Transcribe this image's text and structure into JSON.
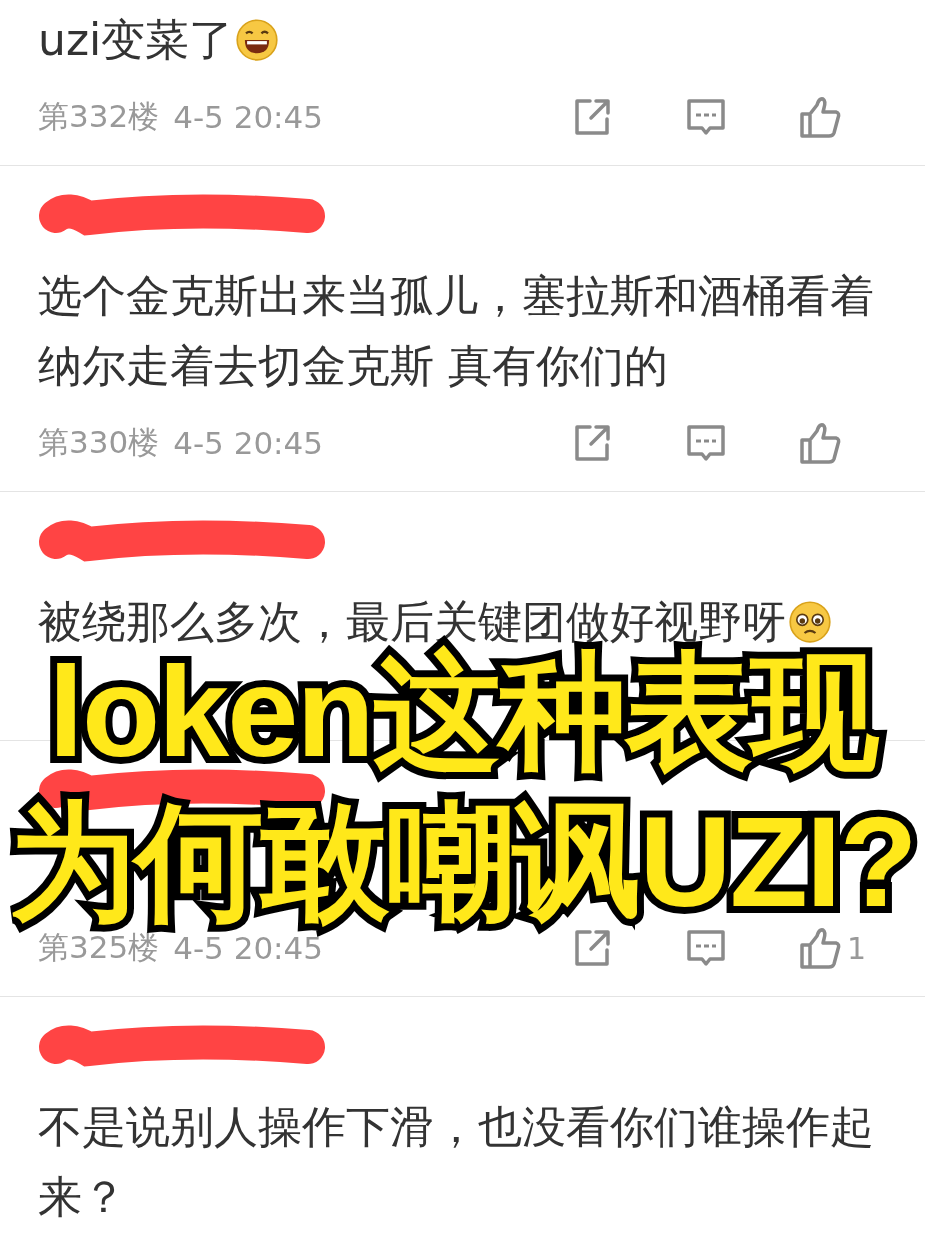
{
  "comments": [
    {
      "redacted": false,
      "lines": [
        "uzi变菜了"
      ],
      "emoji": {
        "kind": "laugh"
      },
      "floor": "第332楼",
      "time": "4-5 20:45"
    },
    {
      "redacted": true,
      "lines": [
        "选个金克斯出来当孤儿，塞拉斯和酒桶看着",
        "纳尔走着去切金克斯 真有你们的"
      ],
      "floor": "第330楼",
      "time": "4-5 20:45"
    },
    {
      "redacted": true,
      "lines": [
        "被绕那么多次，最后关键团做好视野呀"
      ],
      "emoji": {
        "kind": "tear"
      }
    },
    {
      "redacted": true,
      "floor": "第325楼",
      "time": "4-5 20:45",
      "likes": "1"
    },
    {
      "redacted": true,
      "lines": [
        "不是说别人操作下滑，也没看你们谁操作起",
        "来？"
      ]
    }
  ],
  "caption": {
    "lines": [
      "loken这种表现",
      "为何敢嘲讽UZI?"
    ]
  }
}
